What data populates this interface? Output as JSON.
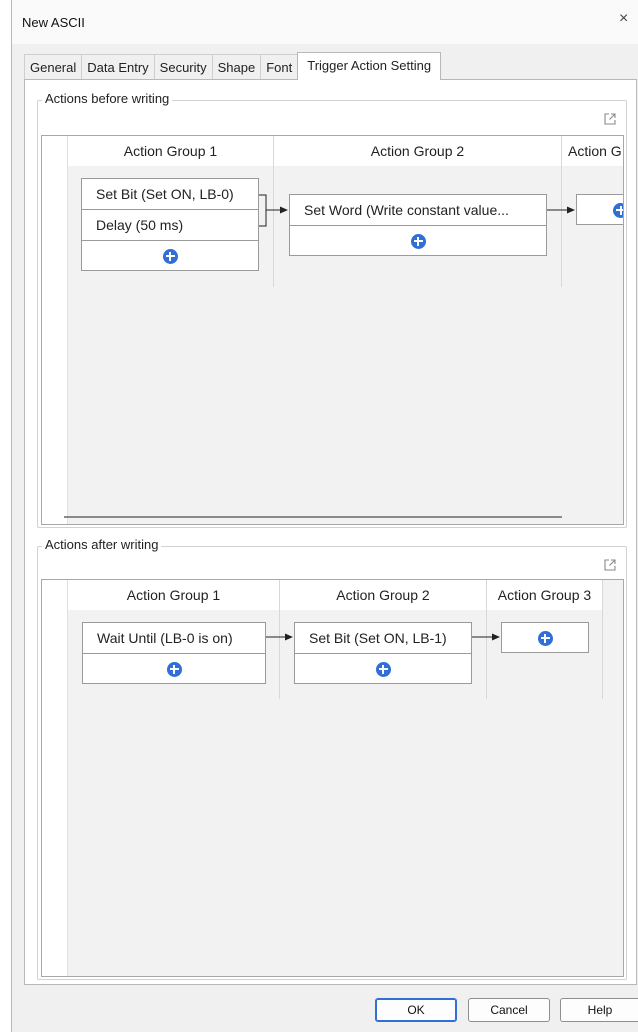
{
  "window": {
    "title": "New ASCII",
    "close_glyph": "×"
  },
  "tabs": [
    {
      "label": "General"
    },
    {
      "label": "Data Entry"
    },
    {
      "label": "Security"
    },
    {
      "label": "Shape"
    },
    {
      "label": "Font"
    },
    {
      "label": "Trigger Action Setting",
      "active": true
    }
  ],
  "before_writing": {
    "legend": "Actions before writing",
    "groups": [
      {
        "header": "Action Group 1",
        "actions": [
          "Set Bit (Set ON, LB-0)",
          "Delay (50 ms)"
        ]
      },
      {
        "header": "Action Group 2",
        "actions": [
          "Set Word (Write constant value..."
        ]
      },
      {
        "header": "Action G",
        "actions": []
      }
    ]
  },
  "after_writing": {
    "legend": "Actions after writing",
    "groups": [
      {
        "header": "Action Group 1",
        "actions": [
          "Wait Until (LB-0 is on)"
        ]
      },
      {
        "header": "Action Group 2",
        "actions": [
          "Set Bit (Set ON, LB-1)"
        ]
      },
      {
        "header": "Action Group 3",
        "actions": []
      }
    ]
  },
  "buttons": {
    "ok": "OK",
    "cancel": "Cancel",
    "help": "Help"
  },
  "colors": {
    "accent": "#2f6fd6",
    "panel_bg": "#f2f2f2",
    "window_bg": "#f0f0f0"
  },
  "icons": {
    "add": "plus-circle-icon",
    "expand": "expand-window-icon",
    "close": "close-icon"
  }
}
